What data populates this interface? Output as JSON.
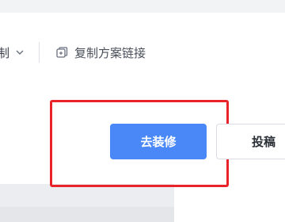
{
  "toolbar": {
    "dropdown_partial_label": "制",
    "copy_link_label": "复制方案链接"
  },
  "actions": {
    "decorate_label": "去装修",
    "submit_label": "投稿"
  },
  "icons": {
    "dropdown": "chevron-down-icon",
    "copy": "copy-icon"
  },
  "colors": {
    "primary": "#4b88f7",
    "highlight_border": "#e8242a"
  }
}
